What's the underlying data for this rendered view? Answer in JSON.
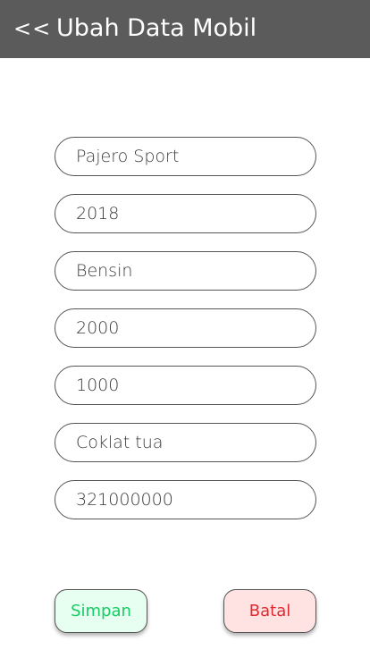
{
  "header": {
    "back_label": "<<",
    "title": "Ubah Data Mobil",
    "background": "#5b5b5b"
  },
  "form": {
    "fields": [
      {
        "value": "Pajero Sport"
      },
      {
        "value": "2018"
      },
      {
        "value": "Bensin"
      },
      {
        "value": "2000"
      },
      {
        "value": "1000"
      },
      {
        "value": "Coklat tua"
      },
      {
        "value": "321000000"
      }
    ]
  },
  "actions": {
    "save_label": "Simpan",
    "save_color": "#17cc65",
    "cancel_label": "Batal",
    "cancel_color": "#e0282e"
  }
}
